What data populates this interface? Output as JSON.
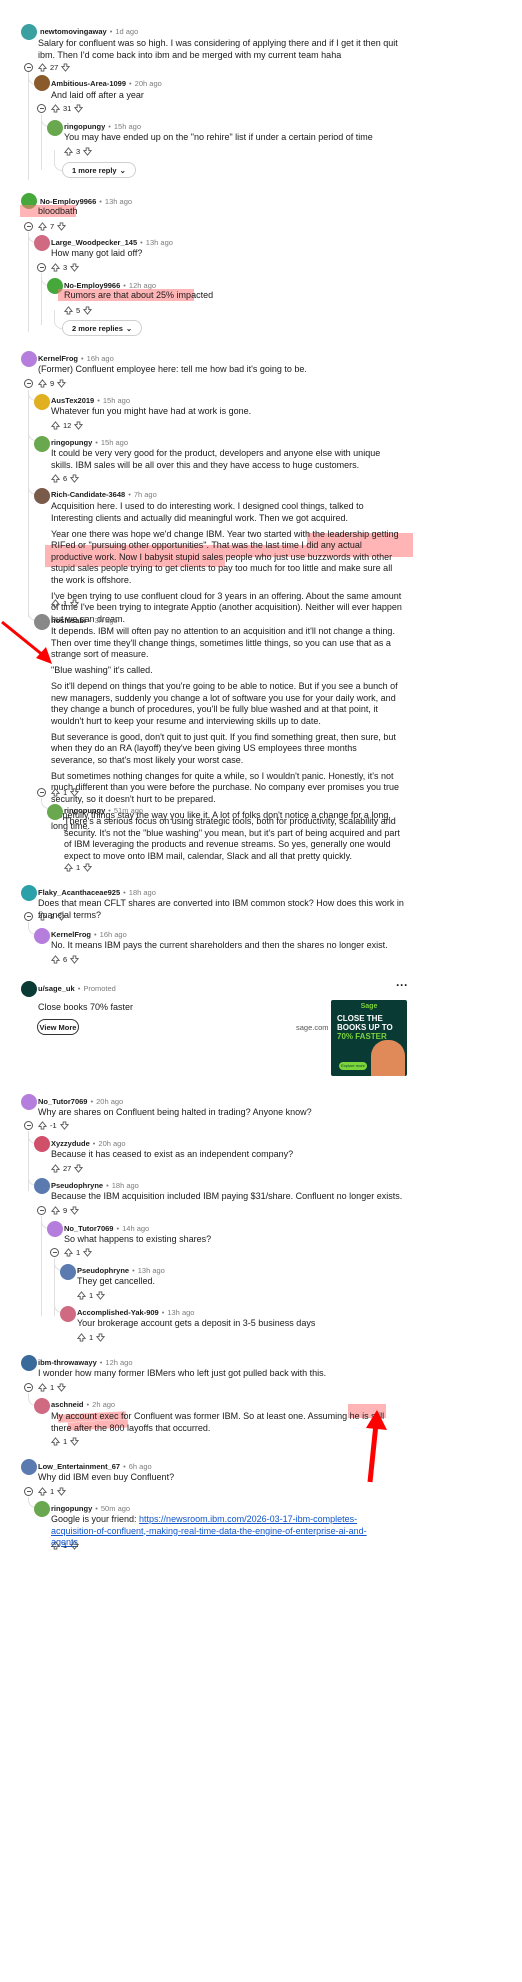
{
  "comments": [
    {
      "user": "newtomovingaway",
      "time": "1d ago",
      "lines": [
        "Salary for confluent was so high. I was considering of applying there and if I get it then quit ibm. Then I'd come back into ibm and be merged with my current team haha"
      ],
      "votes": "27",
      "color": "#3aa0a0"
    },
    {
      "user": "Ambitious-Area-1099",
      "time": "20h ago",
      "lines": [
        "And laid off after a year"
      ],
      "votes": "31",
      "color": "#8a5a2b"
    },
    {
      "user": "ringopungy",
      "time": "15h ago",
      "lines": [
        "You may have ended up on the \"no rehire\" list if under a certain period of time"
      ],
      "votes": "3",
      "color": "#6aa84f"
    },
    {
      "user": "No-Employ9966",
      "time": "13h ago",
      "lines": [
        "bloodbath"
      ],
      "votes": "7",
      "color": "#46a83a"
    },
    {
      "user": "Large_Woodpecker_145",
      "time": "13h ago",
      "lines": [
        "How many got laid off?"
      ],
      "votes": "3",
      "color": "#d06a82"
    },
    {
      "user": "No-Employ9966",
      "time": "12h ago",
      "lines": [
        "Rumors are that about 25% impacted"
      ],
      "votes": "5",
      "color": "#46a83a"
    },
    {
      "user": "KernelFrog",
      "time": "16h ago",
      "lines": [
        "(Former) Confluent employee here: tell me how bad it's going to be."
      ],
      "votes": "9",
      "color": "#b57edc"
    },
    {
      "user": "AusTex2019",
      "time": "15h ago",
      "lines": [
        "Whatever fun you might have had at work is gone."
      ],
      "votes": "12",
      "color": "#e0b020"
    },
    {
      "user": "ringopungy",
      "time": "15h ago",
      "lines": [
        "It could be very very good for the product, developers and anyone else with unique skills. IBM sales will be all over this and they have access to huge customers."
      ],
      "votes": "6",
      "color": "#6aa84f"
    },
    {
      "user": "Rich-Candidate-3648",
      "time": "7h ago",
      "lines": [
        "Acquisition here.  I used to do interesting work.  I designed cool things, talked to Interesting clients and actually did meaningful work. Then we got acquired.",
        "Year one there was hope we'd change IBM.  Year two started with the leadership getting RIFed or \"pursuing other opportunities\".  That was the last time I did any actual productive work.  Now I babysit stupid sales people who just use buzzwords with other stupid sales people trying to get clients to pay too much for too little and make sure all the work is offshore.",
        "I've been trying to use confluent cloud for 3 years in an offering.   About the same amount of time I've been trying to integrate Apptio (another acquisition).   Neither will ever happen but we can dream."
      ],
      "votes": "1",
      "color": "#7a5a4a"
    },
    {
      "user": "hoshisabi",
      "time": "3h ago",
      "lines": [
        "It depends. IBM will often pay no attention to an acquisition and it'll not change a thing. Then over time they'll change things, sometimes little things, so you can use that as a strange sort of measure.",
        "\"Blue washing\" it's called.",
        "So it'll depend on things that you're going to be able to notice. But if you see a bunch of new managers, suddenly you change a lot of software you use for your daily work, and they change a bunch of procedures, you'll be fully blue washed and at that point, it wouldn't hurt to keep your resume and interviewing skills up to date.",
        "But severance is good, don't quit to just quit. If you find something great, then sure, but when they do an RA (layoff) they've been giving US employees three months severance, so that's most likely your worst case.",
        "But sometimes nothing changes for quite a while, so I wouldn't panic. Honestly, it's not much different than you were before the purchase. No company ever promises you true security, so it doesn't hurt to be prepared.",
        "Hopefully things stay the way you like it. A lot of folks don't notice a change for a long, long time."
      ],
      "votes": "1",
      "color": "#888888"
    },
    {
      "user": "ringopungy",
      "time": "51m ago",
      "lines": [
        "There's a serious focus on using strategic tools, both for productivity, scalability and security. It's not the \"blue washing\" you mean, but it's part of being acquired and part of IBM leveraging the products and revenue streams. So yes, generally one would expect to move onto IBM mail, calendar, Slack and all that pretty quickly."
      ],
      "votes": "1",
      "color": "#6aa84f"
    },
    {
      "user": "Flaky_Acanthaceae925",
      "time": "18h ago",
      "lines": [
        "Does that mean CFLT shares are converted into IBM common stock? How does this work in financial terms?"
      ],
      "votes": "2",
      "color": "#2aa0a8"
    },
    {
      "user": "KernelFrog",
      "time": "16h ago",
      "lines": [
        "No. It means IBM pays the current shareholders and then the shares no longer exist."
      ],
      "votes": "6",
      "color": "#b57edc"
    },
    {
      "user": "No_Tutor7069",
      "time": "20h ago",
      "lines": [
        "Why are shares on Confluent being halted in trading? Anyone know?"
      ],
      "votes": "-1",
      "color": "#b57edc"
    },
    {
      "user": "Xyzzydude",
      "time": "20h ago",
      "lines": [
        "Because it has ceased to exist as an independent company?"
      ],
      "votes": "27",
      "color": "#d0506a"
    },
    {
      "user": "Pseudophryne",
      "time": "18h ago",
      "lines": [
        "Because the IBM acquisition included IBM paying $31/share. Confluent no longer exists."
      ],
      "votes": "9",
      "color": "#5a7ab0"
    },
    {
      "user": "No_Tutor7069",
      "time": "14h ago",
      "lines": [
        "So what happens to existing shares?"
      ],
      "votes": "1",
      "color": "#b57edc"
    },
    {
      "user": "Pseudophryne",
      "time": "13h ago",
      "lines": [
        "They get cancelled."
      ],
      "votes": "1",
      "color": "#5a7ab0"
    },
    {
      "user": "Accomplished-Yak-909",
      "time": "13h ago",
      "lines": [
        "Your brokerage account gets a deposit in 3-5 business days"
      ],
      "votes": "1",
      "color": "#d06a82"
    },
    {
      "user": "ibm-throwawayy",
      "time": "12h ago",
      "lines": [
        "I wonder how many former IBMers who left just got pulled back with this."
      ],
      "votes": "1",
      "color": "#3a6a9a"
    },
    {
      "user": "aschneid",
      "time": "2h ago",
      "lines": [
        "My account exec for Confluent was former IBM. So at least one. Assuming he is still there after the 800 layoffs that occurred."
      ],
      "votes": "1",
      "color": "#d06a82"
    },
    {
      "user": "Low_Entertainment_67",
      "time": "6h ago",
      "lines": [
        "Why did IBM even buy Confluent?"
      ],
      "votes": "1",
      "color": "#5a7ab0"
    },
    {
      "user": "ringopungy",
      "time": "50m ago",
      "lines": [
        "Google is your friend: "
      ],
      "link": "https://newsroom.ibm.com/2026-03-17-ibm-completes-acquisition-of-confluent,-making-real-time-data-the-engine-of-enterprise-ai-and-agents",
      "votes": "1",
      "color": "#6aa84f"
    }
  ],
  "more_replies": {
    "one": "1 more reply",
    "two": "2 more replies"
  },
  "ad": {
    "user": "u/sage_uk",
    "tag": "Promoted",
    "text": "Close books 70% faster",
    "button": "View More",
    "domain": "sage.com",
    "brand": "Sage",
    "headline1": "CLOSE THE",
    "headline2": "BOOKS UP TO",
    "headline3": "70% FASTER",
    "cta": "Explore more"
  },
  "colors": {
    "highlight": "#ff7878",
    "arrow": "#ff0000",
    "link": "#1155cc",
    "ad_bg": "#0a3a34",
    "ad_accent": "#7bd43a"
  }
}
